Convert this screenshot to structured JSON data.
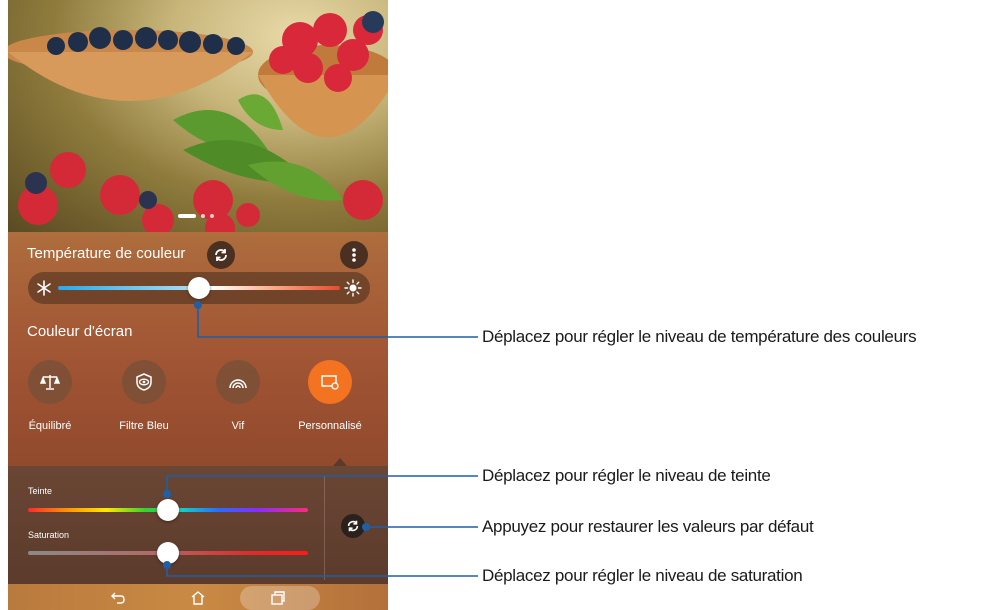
{
  "screen": {
    "color_temperature": {
      "title": "Température de couleur",
      "level": 0.5
    },
    "screen_color": {
      "title": "Couleur d'écran",
      "modes": [
        {
          "label": "Équilibré",
          "icon": "scale-icon",
          "selected": false
        },
        {
          "label": "Filtre Bleu",
          "icon": "eye-shield-icon",
          "selected": false
        },
        {
          "label": "Vif",
          "icon": "vivid-arcs-icon",
          "selected": false
        },
        {
          "label": "Personnalisé",
          "icon": "custom-screen-gear-icon",
          "selected": true
        }
      ],
      "accent_color": "#f37321"
    },
    "custom": {
      "hue_label": "Teinte",
      "hue_level": 0.5,
      "saturation_label": "Saturation",
      "saturation_level": 0.5
    },
    "nav": {
      "icons": [
        "back-icon",
        "home-icon",
        "recent-apps-icon"
      ]
    }
  },
  "callouts": {
    "temperature": "Déplacez pour régler le niveau de température des couleurs",
    "hue": "Déplacez pour régler le niveau de teinte",
    "reset": "Appuyez pour restaurer les valeurs par défaut",
    "saturation": "Déplacez pour régler le niveau de saturation"
  }
}
